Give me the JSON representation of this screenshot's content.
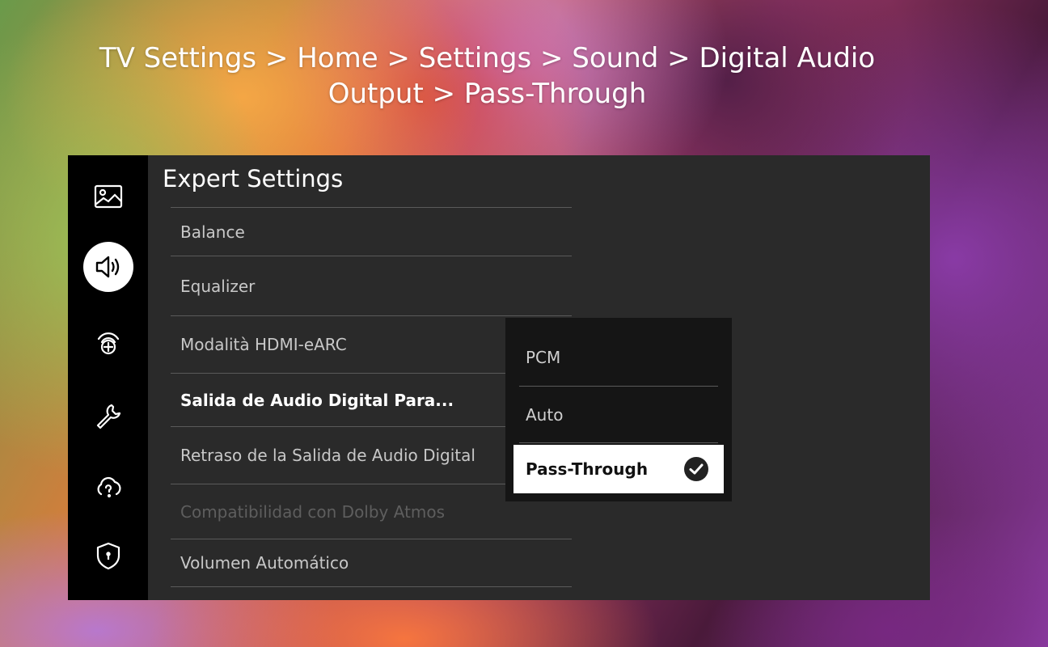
{
  "breadcrumb": {
    "line1": "TV Settings > Home > Settings > Sound > Digital Audio",
    "line2": "Output > Pass-Through"
  },
  "sidebar": {
    "items": [
      {
        "icon": "picture-icon"
      },
      {
        "icon": "sound-icon",
        "active": true
      },
      {
        "icon": "network-icon"
      },
      {
        "icon": "wrench-icon"
      },
      {
        "icon": "cloud-help-icon"
      },
      {
        "icon": "shield-icon"
      }
    ]
  },
  "panel": {
    "title": "Expert Settings",
    "items": [
      {
        "label": "Balance"
      },
      {
        "label": "Equalizer"
      },
      {
        "label": "Modalità HDMI-eARC"
      },
      {
        "label": "Salida de Audio Digital Para...",
        "selected": true
      },
      {
        "label": "Retraso de la Salida de Audio Digital"
      },
      {
        "label": "Compatibilidad con Dolby Atmos",
        "disabled": true
      },
      {
        "label": "Volumen Automático"
      }
    ]
  },
  "dropdown": {
    "options": [
      {
        "label": "PCM"
      },
      {
        "label": "Auto"
      },
      {
        "label": "Pass-Through",
        "selected": true
      }
    ],
    "selected_icon": "checkmark-icon"
  },
  "colors": {
    "panel_bg": "#2a2a2a",
    "sidebar_bg": "#000000",
    "dropdown_bg": "#151515",
    "selected_bg": "#ffffff"
  }
}
